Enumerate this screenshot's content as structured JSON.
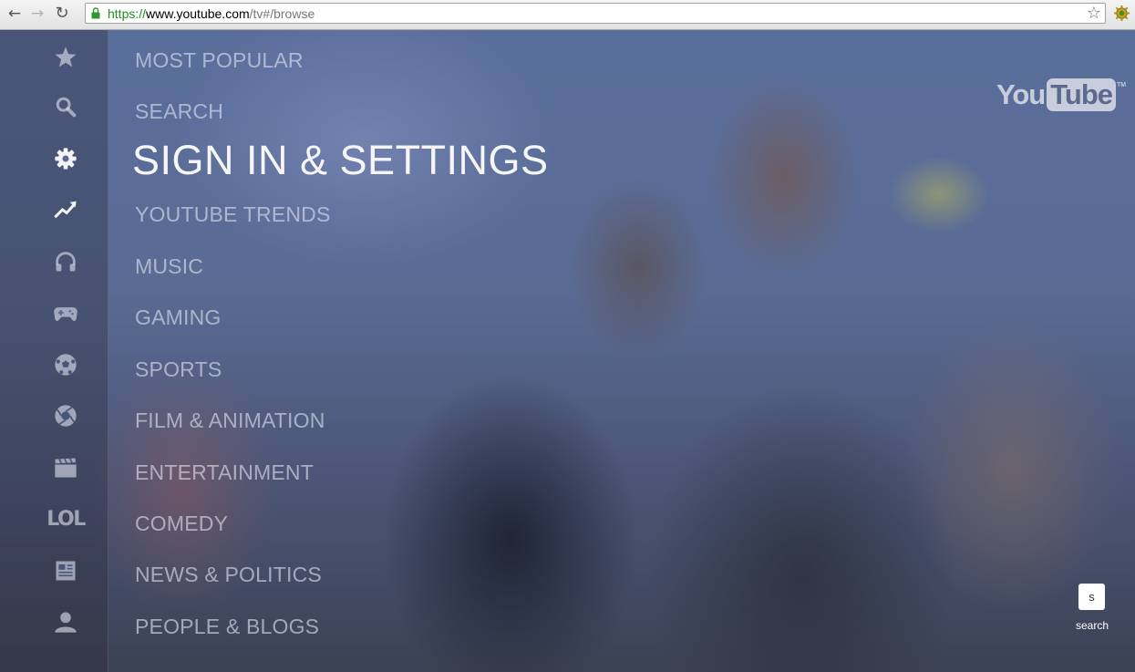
{
  "browser": {
    "url_scheme": "https://",
    "url_host": "www.youtube.com",
    "url_path": "/tv#/browse"
  },
  "sidebar_icons": [
    "star-icon",
    "search-icon",
    "gear-icon",
    "trending-icon",
    "headphones-icon",
    "gamepad-icon",
    "soccer-ball-icon",
    "camera-aperture-icon",
    "clapperboard-icon",
    "lol-icon",
    "newspaper-icon",
    "person-icon"
  ],
  "lol_label": "LOL",
  "menu": {
    "items": [
      "MOST POPULAR",
      "SEARCH",
      "SIGN IN & SETTINGS",
      "YOUTUBE TRENDS",
      "MUSIC",
      "GAMING",
      "SPORTS",
      "FILM & ANIMATION",
      "ENTERTAINMENT",
      "COMEDY",
      "NEWS & POLITICS",
      "PEOPLE & BLOGS"
    ],
    "active_item": "SIGN IN & SETTINGS"
  },
  "logo": {
    "you": "You",
    "tube": "Tube",
    "tm": "TM"
  },
  "search_shortcut": {
    "key": "s",
    "label": "search"
  }
}
